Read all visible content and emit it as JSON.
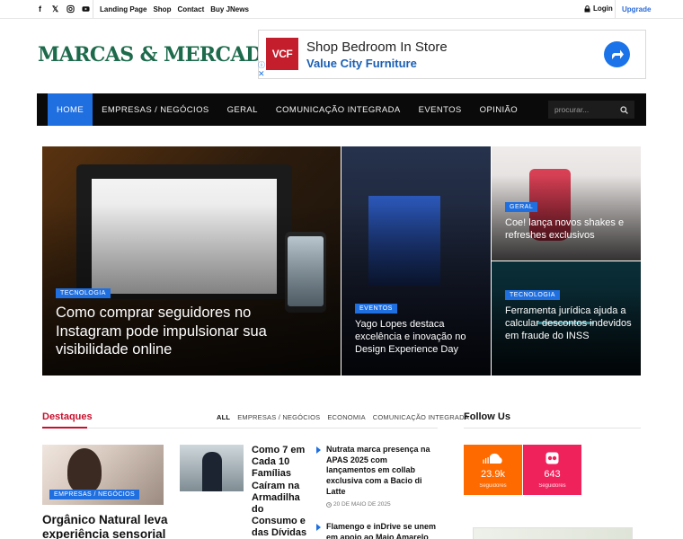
{
  "topbar": {
    "social_icons": [
      "facebook-icon",
      "x-icon",
      "instagram-icon",
      "youtube-icon"
    ],
    "links": [
      "Landing Page",
      "Shop",
      "Contact",
      "Buy JNews"
    ],
    "login": "Login",
    "upgrade": "Upgrade"
  },
  "logo": "MARCAS & MERCADOS",
  "ad": {
    "logo_text": "VCF",
    "title": "Shop Bedroom In Store",
    "subtitle": "Value City Furniture"
  },
  "nav": {
    "items": [
      "HOME",
      "EMPRESAS / NEGÓCIOS",
      "GERAL",
      "COMUNICAÇÃO INTEGRADA",
      "EVENTOS",
      "OPINIÃO"
    ],
    "active": "HOME",
    "search_placeholder": "procurar..."
  },
  "hero": {
    "main": {
      "category": "TECNOLOGIA",
      "title": "Como comprar seguidores no Instagram pode impulsionar sua visibilidade online"
    },
    "middle": {
      "category": "EVENTOS",
      "title": "Yago Lopes destaca excelência e inovação no Design Experience Day"
    },
    "top_right": {
      "category": "GERAL",
      "title": "Coe! lança novos shakes e refreshes exclusivos"
    },
    "bottom_right": {
      "category": "TECNOLOGIA",
      "title": "Ferramenta jurídica ajuda a calcular descontos indevidos em fraude do INSS"
    }
  },
  "destaques": {
    "title": "Destaques",
    "filters": [
      "ALL",
      "EMPRESAS / NEGÓCIOS",
      "ECONOMIA",
      "COMUNICAÇÃO INTEGRADA"
    ],
    "card1": {
      "category": "EMPRESAS / NEGÓCIOS",
      "title": "Orgânico Natural leva experiência sensorial"
    },
    "card2": {
      "title": "Como 7 em Cada 10 Famílias Caíram na Armadilha do Consumo e das Dívidas"
    },
    "list": [
      {
        "title": "Nutrata marca presença na APAS 2025 com lançamentos em collab exclusiva com a Bacio di Latte",
        "date": "20 DE MAIO DE 2025"
      },
      {
        "title": "Flamengo e inDrive se unem em apoio ao Maio Amarelo",
        "date": ""
      }
    ]
  },
  "follow": {
    "title": "Follow Us",
    "boxes": [
      {
        "network": "soundcloud-icon",
        "count": "23.9k",
        "label": "Seguidores",
        "color": "#ff6a00"
      },
      {
        "network": "flickr-icon",
        "count": "643",
        "label": "Seguidores",
        "color": "#f0225c"
      }
    ]
  }
}
